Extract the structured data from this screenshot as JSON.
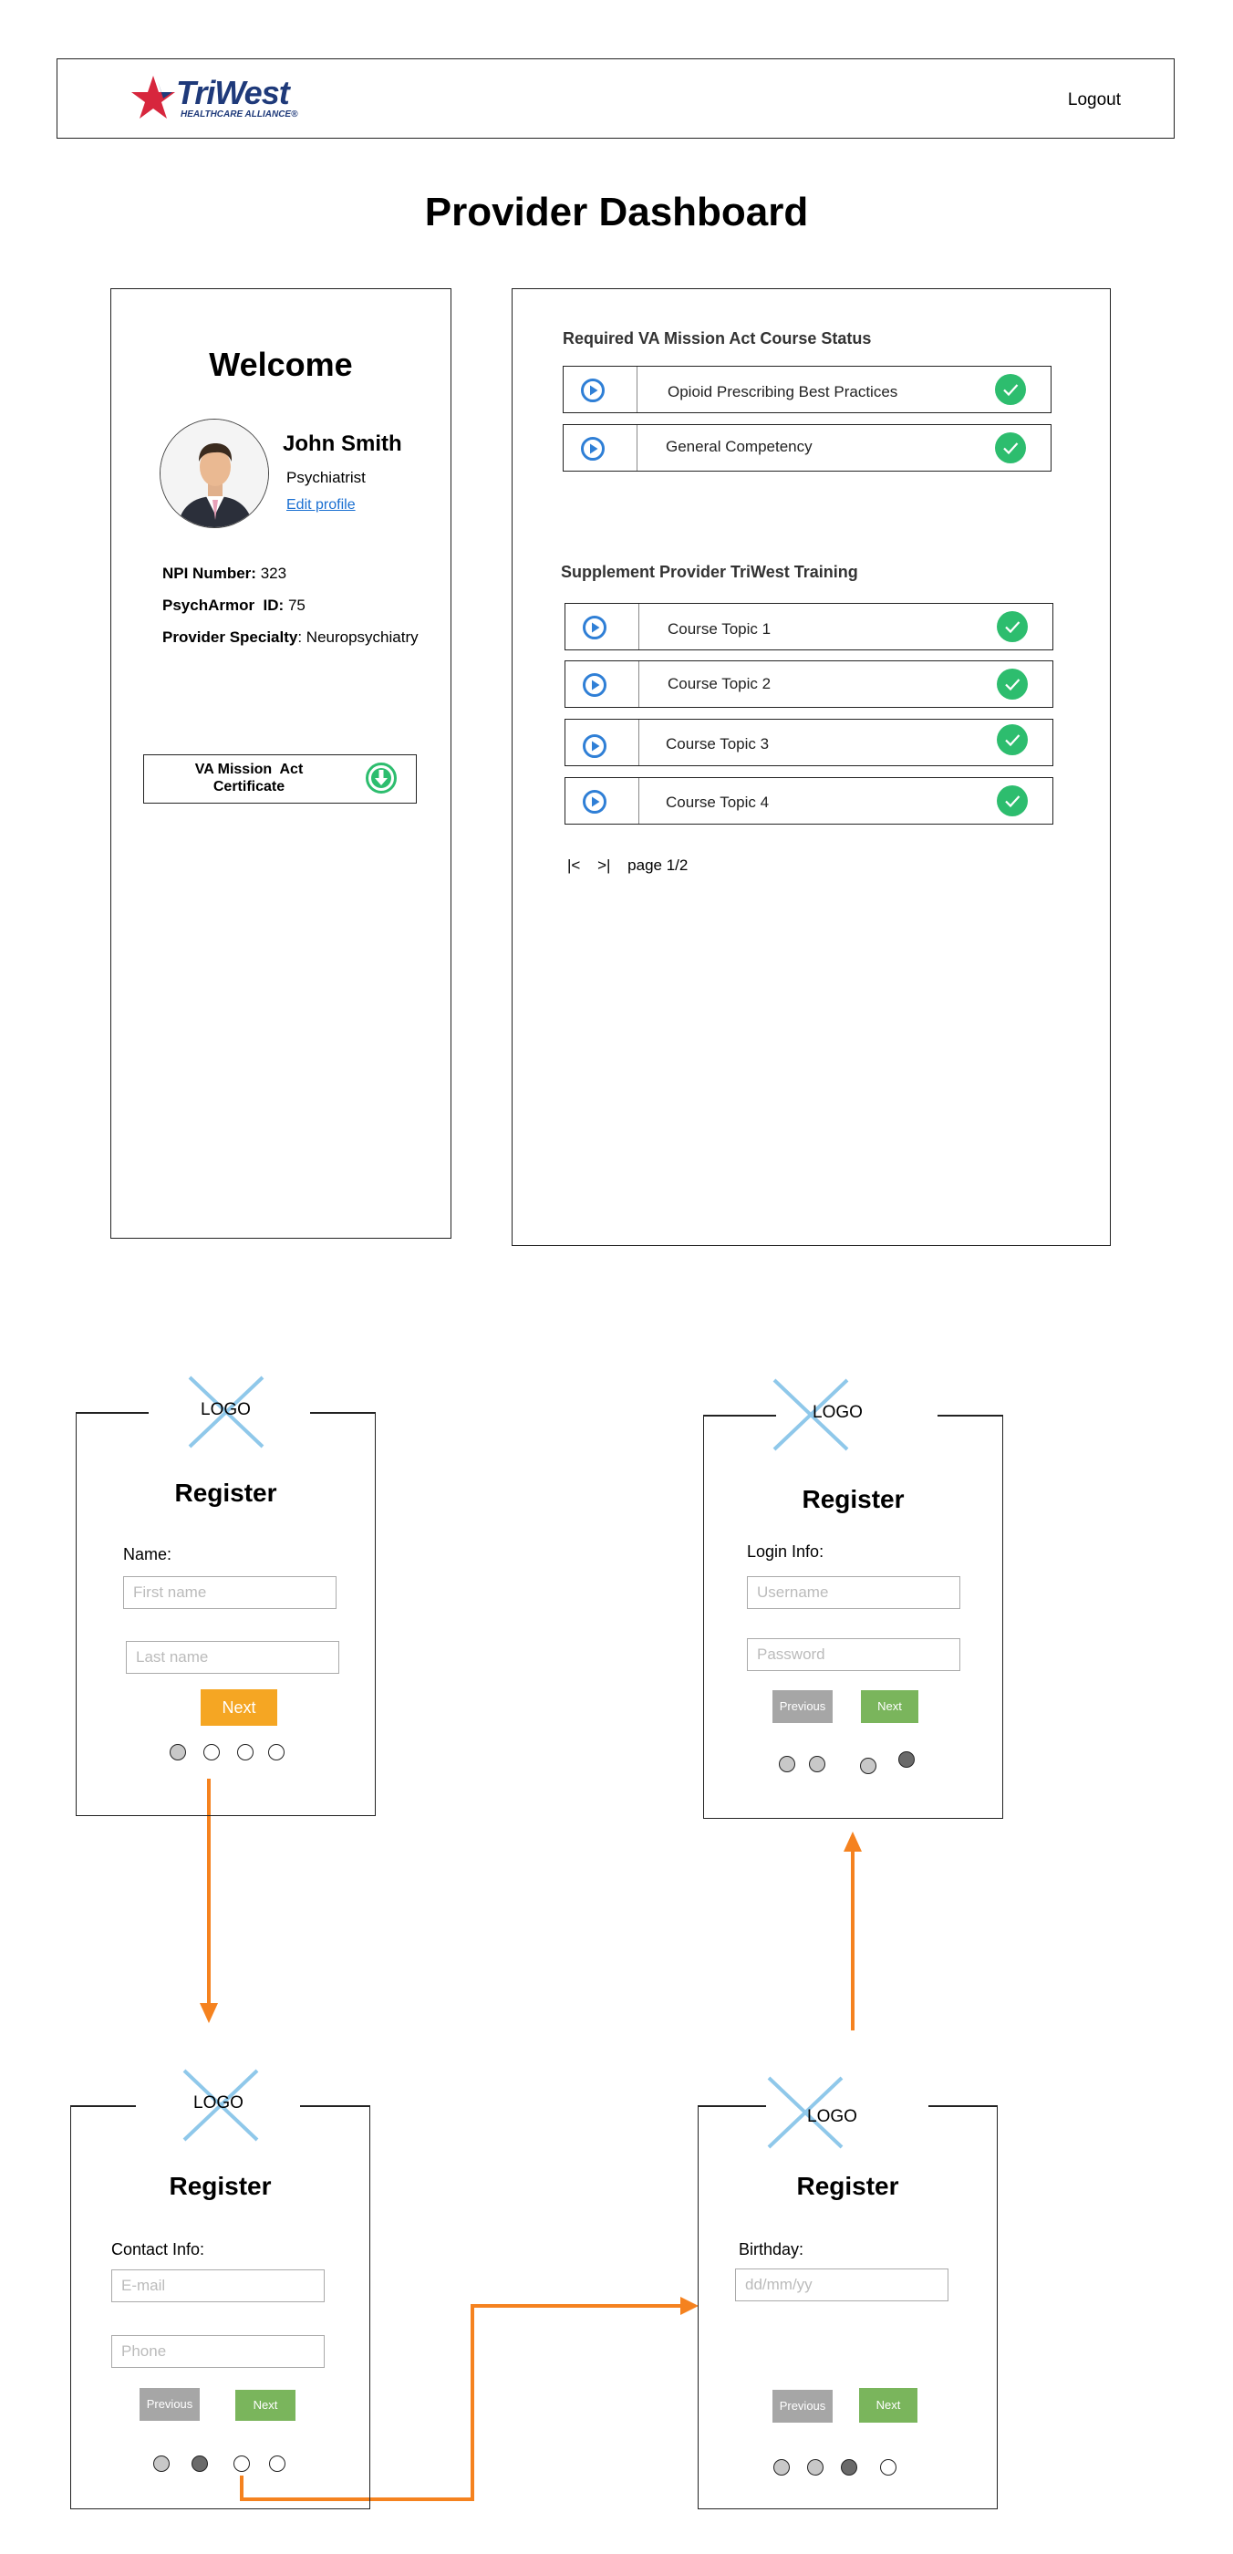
{
  "header": {
    "brand": "TriWest",
    "brand_sub": "HEALTHCARE ALLIANCE®",
    "logout_label": "Logout"
  },
  "page_title": "Provider Dashboard",
  "profile": {
    "welcome": "Welcome",
    "name": "John Smith",
    "role": "Psychiatrist",
    "edit_link": "Edit profile",
    "npi_label": "NPI Number:",
    "npi_value": "323",
    "psycharmor_label": "PsychArmor  ID:",
    "psycharmor_value": "75",
    "specialty_label": "Provider Specialty",
    "specialty_value": ": Neuropsychiatry",
    "certificate_label": "VA Mission  Act Certificate"
  },
  "required_section": {
    "title": "Required VA Mission Act Course Status",
    "courses": [
      {
        "label": "Opioid Prescribing Best Practices"
      },
      {
        "label": "General Competency"
      }
    ]
  },
  "supplement_section": {
    "title": "Supplement Provider TriWest Training",
    "courses": [
      {
        "label": "Course Topic 1"
      },
      {
        "label": "Course Topic 2"
      },
      {
        "label": "Course Topic 3"
      },
      {
        "label": "Course Topic 4"
      }
    ]
  },
  "pager": {
    "first_icon": "|<",
    "last_icon": ">|",
    "label": "page 1/2"
  },
  "register_flow": {
    "logo_text": "LOGO",
    "title": "Register",
    "step1": {
      "field_label": "Name:",
      "first_placeholder": "First name",
      "last_placeholder": "Last name",
      "next_label": "Next"
    },
    "step2": {
      "field_label": "Contact Info:",
      "email_placeholder": "E-mail",
      "phone_placeholder": "Phone",
      "previous_label": "Previous",
      "next_label": "Next"
    },
    "step3": {
      "field_label": "Birthday:",
      "birthday_placeholder": "dd/mm/yy",
      "previous_label": "Previous",
      "next_label": "Next"
    },
    "step4": {
      "field_label": "Login Info:",
      "username_placeholder": "Username",
      "password_placeholder": "Password",
      "previous_label": "Previous",
      "next_label": "Next"
    },
    "arrow_color": "#f5821f"
  },
  "colors": {
    "check_green": "#2dbd6e",
    "play_blue": "#2f7fd6",
    "link_blue": "#1a6fd1",
    "next_orange": "#f5a623",
    "next_green": "#7ab55c",
    "previous_gray": "#a6a6a6"
  }
}
